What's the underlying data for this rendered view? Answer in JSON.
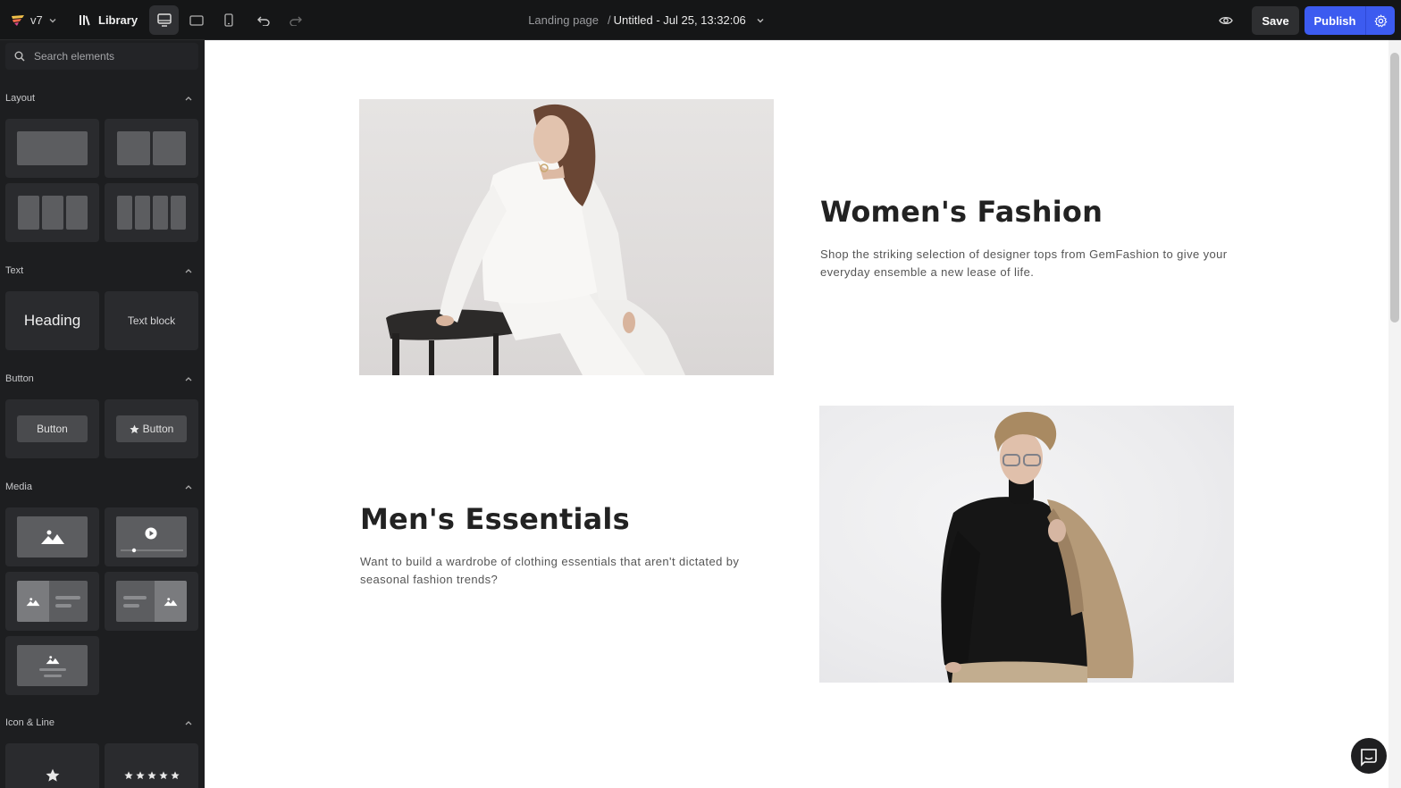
{
  "topbar": {
    "version": "v7",
    "library_label": "Library",
    "breadcrumb_page": "Landing page",
    "breadcrumb_separator": "/",
    "page_title": "Untitled - Jul 25, 13:32:06",
    "save_label": "Save",
    "publish_label": "Publish",
    "active_device": "desktop"
  },
  "sidebar": {
    "search_placeholder": "Search elements",
    "sections": {
      "layout": "Layout",
      "text": "Text",
      "button": "Button",
      "media": "Media",
      "icon_line": "Icon & Line"
    },
    "text_tiles": {
      "heading": "Heading",
      "text_block": "Text block"
    },
    "button_tiles": {
      "button": "Button",
      "icon_button": "Button"
    }
  },
  "content": {
    "women": {
      "title": "Women's Fashion",
      "description_line1": "Shop the striking selection of designer tops from GemFashion to give your",
      "description_line2": "everyday ensemble a new lease of life."
    },
    "men": {
      "title": "Men's Essentials",
      "description_line1": "Want to build a wardrobe of clothing essentials that aren't dictated by",
      "description_line2": "seasonal fashion trends?"
    }
  },
  "colors": {
    "topbar_bg": "#151617",
    "sidebar_bg": "#1d1e20",
    "publish_accent": "#3c5bf0",
    "heading_text": "#222222"
  }
}
